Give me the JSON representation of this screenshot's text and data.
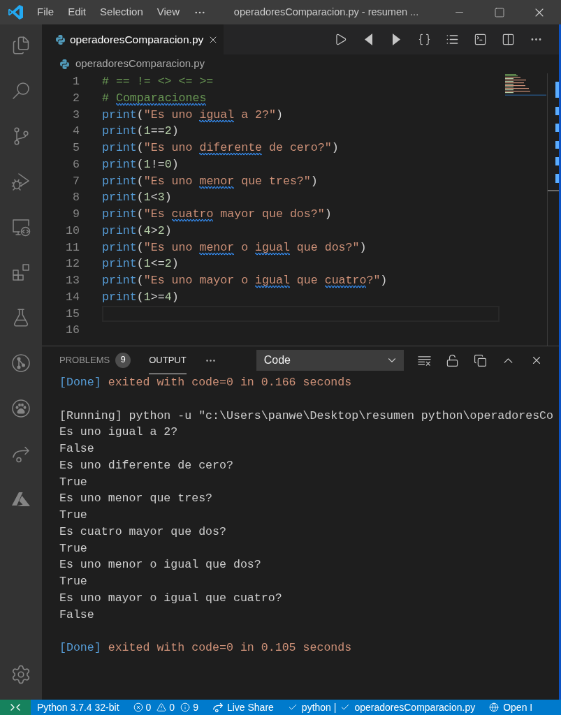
{
  "title_bar": {
    "menu": [
      "File",
      "Edit",
      "Selection",
      "View"
    ],
    "title": "operadoresComparacion.py - resumen ..."
  },
  "tabs": [
    {
      "label": "operadoresComparacion.py",
      "selected": true
    }
  ],
  "breadcrumb": [
    "operadoresComparacion.py"
  ],
  "editor": {
    "lines": [
      {
        "number": "1",
        "tokens": [
          {
            "kind": "comment",
            "text": "# == != <> <= >="
          }
        ]
      },
      {
        "number": "2",
        "tokens": [
          {
            "kind": "comment",
            "text": "# "
          },
          {
            "kind": "comment",
            "text": "Comparaciones",
            "squiggle": true
          }
        ]
      },
      {
        "number": "3",
        "tokens": [
          {
            "kind": "builtin",
            "text": "print"
          },
          {
            "kind": "punct",
            "text": "("
          },
          {
            "kind": "string",
            "text": "\"Es uno "
          },
          {
            "kind": "string",
            "text": "igual",
            "squiggle": true
          },
          {
            "kind": "string",
            "text": " a 2?\""
          },
          {
            "kind": "punct",
            "text": ")"
          }
        ]
      },
      {
        "number": "4",
        "tokens": [
          {
            "kind": "builtin",
            "text": "print"
          },
          {
            "kind": "punct",
            "text": "("
          },
          {
            "kind": "number",
            "text": "1"
          },
          {
            "kind": "operator",
            "text": "=="
          },
          {
            "kind": "number",
            "text": "2"
          },
          {
            "kind": "punct",
            "text": ")"
          }
        ]
      },
      {
        "number": "5",
        "tokens": [
          {
            "kind": "builtin",
            "text": "print"
          },
          {
            "kind": "punct",
            "text": "("
          },
          {
            "kind": "string",
            "text": "\"Es uno "
          },
          {
            "kind": "string",
            "text": "diferente",
            "squiggle": true
          },
          {
            "kind": "string",
            "text": " de cero?\""
          },
          {
            "kind": "punct",
            "text": ")"
          }
        ]
      },
      {
        "number": "6",
        "tokens": [
          {
            "kind": "builtin",
            "text": "print"
          },
          {
            "kind": "punct",
            "text": "("
          },
          {
            "kind": "number",
            "text": "1"
          },
          {
            "kind": "operator",
            "text": "!="
          },
          {
            "kind": "number",
            "text": "0"
          },
          {
            "kind": "punct",
            "text": ")"
          }
        ]
      },
      {
        "number": "7",
        "tokens": [
          {
            "kind": "builtin",
            "text": "print"
          },
          {
            "kind": "punct",
            "text": "("
          },
          {
            "kind": "string",
            "text": "\"Es uno "
          },
          {
            "kind": "string",
            "text": "menor",
            "squiggle": true
          },
          {
            "kind": "string",
            "text": " que tres?\""
          },
          {
            "kind": "punct",
            "text": ")"
          }
        ]
      },
      {
        "number": "8",
        "tokens": [
          {
            "kind": "builtin",
            "text": "print"
          },
          {
            "kind": "punct",
            "text": "("
          },
          {
            "kind": "number",
            "text": "1"
          },
          {
            "kind": "operator",
            "text": "<"
          },
          {
            "kind": "number",
            "text": "3"
          },
          {
            "kind": "punct",
            "text": ")"
          }
        ]
      },
      {
        "number": "9",
        "tokens": [
          {
            "kind": "builtin",
            "text": "print"
          },
          {
            "kind": "punct",
            "text": "("
          },
          {
            "kind": "string",
            "text": "\"Es "
          },
          {
            "kind": "string",
            "text": "cuatro",
            "squiggle": true
          },
          {
            "kind": "string",
            "text": " mayor que dos?\""
          },
          {
            "kind": "punct",
            "text": ")"
          }
        ]
      },
      {
        "number": "10",
        "tokens": [
          {
            "kind": "builtin",
            "text": "print"
          },
          {
            "kind": "punct",
            "text": "("
          },
          {
            "kind": "number",
            "text": "4"
          },
          {
            "kind": "operator",
            "text": ">"
          },
          {
            "kind": "number",
            "text": "2"
          },
          {
            "kind": "punct",
            "text": ")"
          }
        ]
      },
      {
        "number": "11",
        "tokens": [
          {
            "kind": "builtin",
            "text": "print"
          },
          {
            "kind": "punct",
            "text": "("
          },
          {
            "kind": "string",
            "text": "\"Es uno "
          },
          {
            "kind": "string",
            "text": "menor",
            "squiggle": true
          },
          {
            "kind": "string",
            "text": " o "
          },
          {
            "kind": "string",
            "text": "igual",
            "squiggle": true
          },
          {
            "kind": "string",
            "text": " que dos?\""
          },
          {
            "kind": "punct",
            "text": ")"
          }
        ]
      },
      {
        "number": "12",
        "tokens": [
          {
            "kind": "builtin",
            "text": "print"
          },
          {
            "kind": "punct",
            "text": "("
          },
          {
            "kind": "number",
            "text": "1"
          },
          {
            "kind": "operator",
            "text": "<="
          },
          {
            "kind": "number",
            "text": "2"
          },
          {
            "kind": "punct",
            "text": ")"
          }
        ]
      },
      {
        "number": "13",
        "tokens": [
          {
            "kind": "builtin",
            "text": "print"
          },
          {
            "kind": "punct",
            "text": "("
          },
          {
            "kind": "string",
            "text": "\"Es uno mayor o "
          },
          {
            "kind": "string",
            "text": "igual",
            "squiggle": true
          },
          {
            "kind": "string",
            "text": " que "
          },
          {
            "kind": "string",
            "text": "cuatro",
            "squiggle": true
          },
          {
            "kind": "string",
            "text": "?\""
          },
          {
            "kind": "punct",
            "text": ")"
          }
        ]
      },
      {
        "number": "14",
        "tokens": [
          {
            "kind": "builtin",
            "text": "print"
          },
          {
            "kind": "punct",
            "text": "("
          },
          {
            "kind": "number",
            "text": "1"
          },
          {
            "kind": "operator",
            "text": ">="
          },
          {
            "kind": "number",
            "text": "4"
          },
          {
            "kind": "punct",
            "text": ")"
          }
        ]
      },
      {
        "number": "15",
        "current": true
      },
      {
        "number": "16"
      }
    ]
  },
  "panel": {
    "tabs": [
      {
        "label": "PROBLEMS",
        "badge": "9",
        "selected": false
      },
      {
        "label": "OUTPUT",
        "selected": true
      }
    ],
    "channel": "Code",
    "output": [
      {
        "kind": "status",
        "label": "[Done]",
        "text": "exited with code=0 in 0.166 seconds"
      },
      {
        "kind": "blank"
      },
      {
        "kind": "plain",
        "text": "[Running] python -u \"c:\\Users\\panwe\\Desktop\\resumen python\\operadoresCo"
      },
      {
        "kind": "plain",
        "text": "Es uno igual a 2?"
      },
      {
        "kind": "plain",
        "text": "False"
      },
      {
        "kind": "plain",
        "text": "Es uno diferente de cero?"
      },
      {
        "kind": "plain",
        "text": "True"
      },
      {
        "kind": "plain",
        "text": "Es uno menor que tres?"
      },
      {
        "kind": "plain",
        "text": "True"
      },
      {
        "kind": "plain",
        "text": "Es cuatro mayor que dos?"
      },
      {
        "kind": "plain",
        "text": "True"
      },
      {
        "kind": "plain",
        "text": "Es uno menor o igual que dos?"
      },
      {
        "kind": "plain",
        "text": "True"
      },
      {
        "kind": "plain",
        "text": "Es uno mayor o igual que cuatro?"
      },
      {
        "kind": "plain",
        "text": "False"
      },
      {
        "kind": "blank"
      },
      {
        "kind": "status",
        "label": "[Done]",
        "text": "exited with code=0 in 0.105 seconds"
      }
    ]
  },
  "status_bar": {
    "interpreter": "Python 3.7.4 32-bit",
    "problems": {
      "errors": "0",
      "warnings": "0",
      "infos": "9"
    },
    "live_share": "Live Share",
    "checks": [
      "python |",
      "operadoresComparacion.py"
    ],
    "open_in": "Open I"
  }
}
